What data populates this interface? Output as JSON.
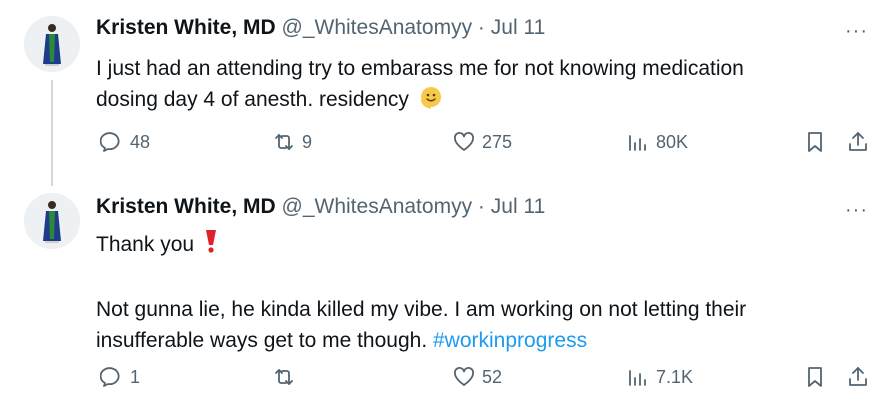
{
  "tweets": [
    {
      "author_name": "Kristen White, MD",
      "handle": "@_WhitesAnatomyy",
      "separator": "·",
      "date": "Jul 11",
      "more": "···",
      "text_lines": [
        "I just had an attending try to embarass me for not knowing medication",
        "dosing day 4 of anesth. residency"
      ],
      "emoji": "smiling-face-emoji",
      "stats": {
        "replies": "48",
        "reposts": "9",
        "likes": "275",
        "views": "80K"
      }
    },
    {
      "author_name": "Kristen White, MD",
      "handle": "@_WhitesAnatomyy",
      "separator": "·",
      "date": "Jul 11",
      "more": "···",
      "first_line": "Thank you",
      "first_line_emoji": "red-exclamation-emoji",
      "text_lines": [
        "Not gunna lie, he kinda killed my vibe. I am working on not letting their",
        "insufferable ways get to me though."
      ],
      "hashtag": "#workinprogress",
      "stats": {
        "replies": "1",
        "reposts": "",
        "likes": "52",
        "views": "7.1K"
      }
    }
  ],
  "colors": {
    "text": "#0f1419",
    "secondary": "#536471",
    "link": "#1d9bf0",
    "thread_line": "#cfd9de"
  }
}
